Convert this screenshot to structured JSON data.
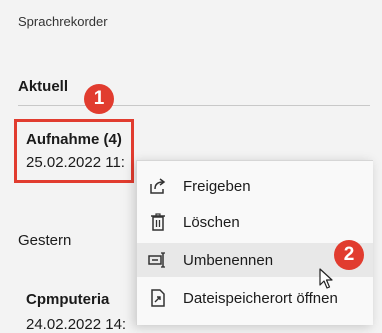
{
  "app": {
    "title": "Sprachrekorder"
  },
  "sections": {
    "current": "Aktuell",
    "yesterday": "Gestern"
  },
  "recordings": [
    {
      "title": "Aufnahme (4)",
      "date": "25.02.2022 11:"
    },
    {
      "title": "Cpmputeria",
      "date": "24.02.2022 14:"
    }
  ],
  "context_menu": {
    "items": [
      {
        "label": "Freigeben",
        "icon": "share-icon"
      },
      {
        "label": "Löschen",
        "icon": "trash-icon"
      },
      {
        "label": "Umbenennen",
        "icon": "rename-icon"
      },
      {
        "label": "Dateispeicherort öffnen",
        "icon": "open-file-location-icon"
      }
    ]
  },
  "annotations": {
    "badge1": "1",
    "badge2": "2"
  },
  "colors": {
    "accent_red": "#e13c2f",
    "background": "#f3f3f3",
    "menu_hover": "#e8e8e8"
  }
}
